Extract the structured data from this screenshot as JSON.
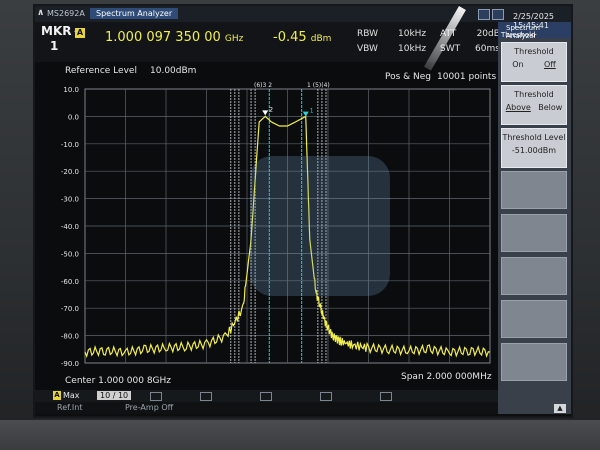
{
  "titlebar": {
    "model": "MS2692A",
    "app_name": "Spectrum Analyzer"
  },
  "datetime": "2/25/2025 15:45:41",
  "marker": {
    "label": "MKR",
    "number": "1",
    "badge": "A",
    "frequency": "1.000 097 350 00",
    "frequency_unit": "GHz",
    "value": "-0.45",
    "value_unit": "dBm"
  },
  "settings": {
    "rbw_label": "RBW",
    "rbw_value": "10kHz",
    "vbw_label": "VBW",
    "vbw_value": "10kHz",
    "att_label": "ATT",
    "att_value": "20dB",
    "swt_label": "SWT",
    "swt_value": "60ms"
  },
  "plot": {
    "ref_level_label": "Reference Level",
    "ref_level_value": "10.00dBm",
    "detection": "Pos & Neg",
    "points": "10001 points",
    "center": "Center 1.000 000 8GHz",
    "span": "Span 2.000 000MHz",
    "marker_tags_left": "(6)3 2",
    "marker_tags_right": "1 (5)(4)"
  },
  "trace": {
    "badge": "A",
    "mode": "Max",
    "count": "10 / 10"
  },
  "status": {
    "item1": "Ref.Int",
    "item2": "Pre-Amp Off"
  },
  "panel": {
    "title": "Spectrum Analyzer",
    "subtitle": "Threshold",
    "threshold": {
      "label": "Threshold",
      "on": "On",
      "off": "Off"
    },
    "threshold_dir": {
      "label": "Threshold",
      "above": "Above",
      "below": "Below"
    },
    "threshold_level": {
      "label": "Threshold Level",
      "value": "-51.00dBm"
    },
    "nav_arrow": "▲"
  },
  "chart_data": {
    "type": "line",
    "title": "",
    "xlabel": "",
    "ylabel": "",
    "y_ticks": [
      "10.0",
      "0.0",
      "-10.0",
      "-20.0",
      "-30.0",
      "-40.0",
      "-50.0",
      "-60.0",
      "-70.0",
      "-80.0",
      "-90.0"
    ],
    "ylim": [
      -90,
      10
    ],
    "xlim": [
      0,
      10
    ],
    "grid": true,
    "series": [
      {
        "color": "#f2ee4a",
        "x": [
          0,
          0.5,
          1.0,
          1.5,
          2.0,
          2.5,
          3.0,
          3.5,
          3.9,
          4.1,
          4.3,
          4.45,
          4.6,
          4.8,
          5.0,
          5.2,
          5.45,
          5.55,
          5.7,
          5.9,
          6.1,
          6.3,
          6.6,
          7.0,
          7.5,
          8.0,
          8.5,
          9.0,
          9.5,
          10.0
        ],
        "y": [
          -86,
          -85.5,
          -86,
          -85,
          -84.5,
          -84,
          -83,
          -80,
          -70,
          -45,
          -2,
          0,
          -2,
          -3.5,
          -3.5,
          -2,
          0,
          -45,
          -64,
          -74,
          -80,
          -82,
          -83.5,
          -84.5,
          -85,
          -85.5,
          -85,
          -86,
          -85.5,
          -86
        ]
      }
    ],
    "markers": [
      {
        "label": "1",
        "x": 5.45,
        "y": -0.45,
        "color": "#35d0d6"
      },
      {
        "label": "2",
        "x": 4.45,
        "y": 0.0,
        "color": "#ffffff"
      }
    ],
    "vertical_lines_white_x": [
      3.6,
      3.7,
      3.8,
      4.1,
      4.2,
      5.75,
      5.85,
      5.95
    ],
    "vertical_lines_cyan_x": [
      4.55,
      5.35
    ]
  }
}
